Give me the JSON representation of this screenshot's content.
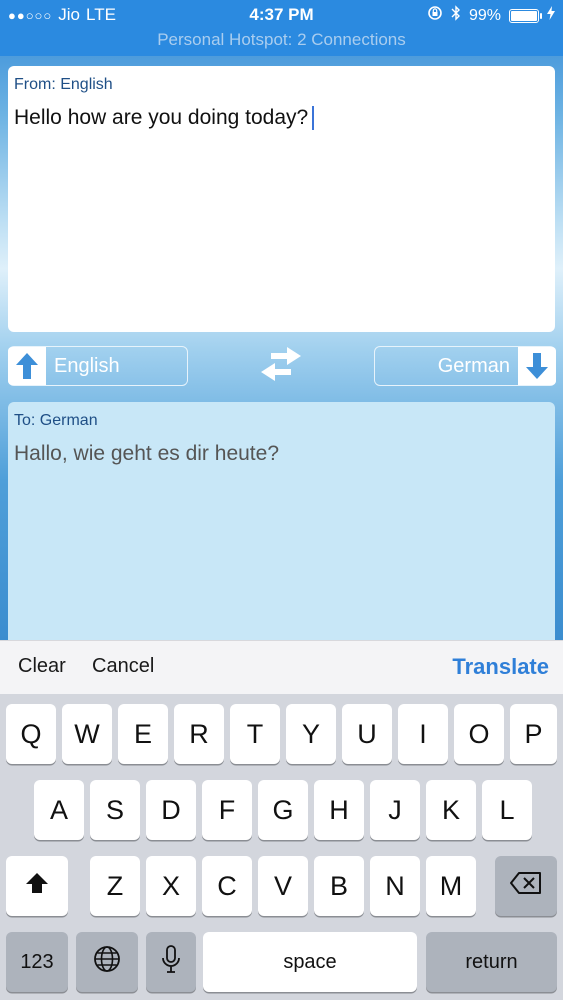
{
  "status_bar": {
    "carrier": "Jio",
    "network": "LTE",
    "time": "4:37 PM",
    "battery": "99%",
    "battery_level": 0.99,
    "hotspot": "Personal Hotspot: 2 Connections"
  },
  "source": {
    "label": "From: English",
    "text": "Hello how are you doing today?"
  },
  "languages": {
    "from": "English",
    "to": "German"
  },
  "target": {
    "label": "To: German",
    "text": "Hallo, wie geht es dir heute?"
  },
  "accessory": {
    "clear": "Clear",
    "cancel": "Cancel",
    "translate": "Translate"
  },
  "keyboard": {
    "row1": [
      "Q",
      "W",
      "E",
      "R",
      "T",
      "Y",
      "U",
      "I",
      "O",
      "P"
    ],
    "row2": [
      "A",
      "S",
      "D",
      "F",
      "G",
      "H",
      "J",
      "K",
      "L"
    ],
    "row3": [
      "Z",
      "X",
      "C",
      "V",
      "B",
      "N",
      "M"
    ],
    "numbers": "123",
    "space": "space",
    "return": "return"
  },
  "colors": {
    "accent": "#2f7fd8",
    "status_bar": "#2b8ae0",
    "target_panel": "#c8e7f7"
  },
  "icons": [
    "signal-dots-icon",
    "rotation-lock-icon",
    "bluetooth-icon",
    "battery-icon",
    "charging-icon",
    "arrow-up-icon",
    "swap-icon",
    "arrow-down-icon",
    "shift-icon",
    "globe-icon",
    "microphone-icon",
    "delete-icon"
  ]
}
